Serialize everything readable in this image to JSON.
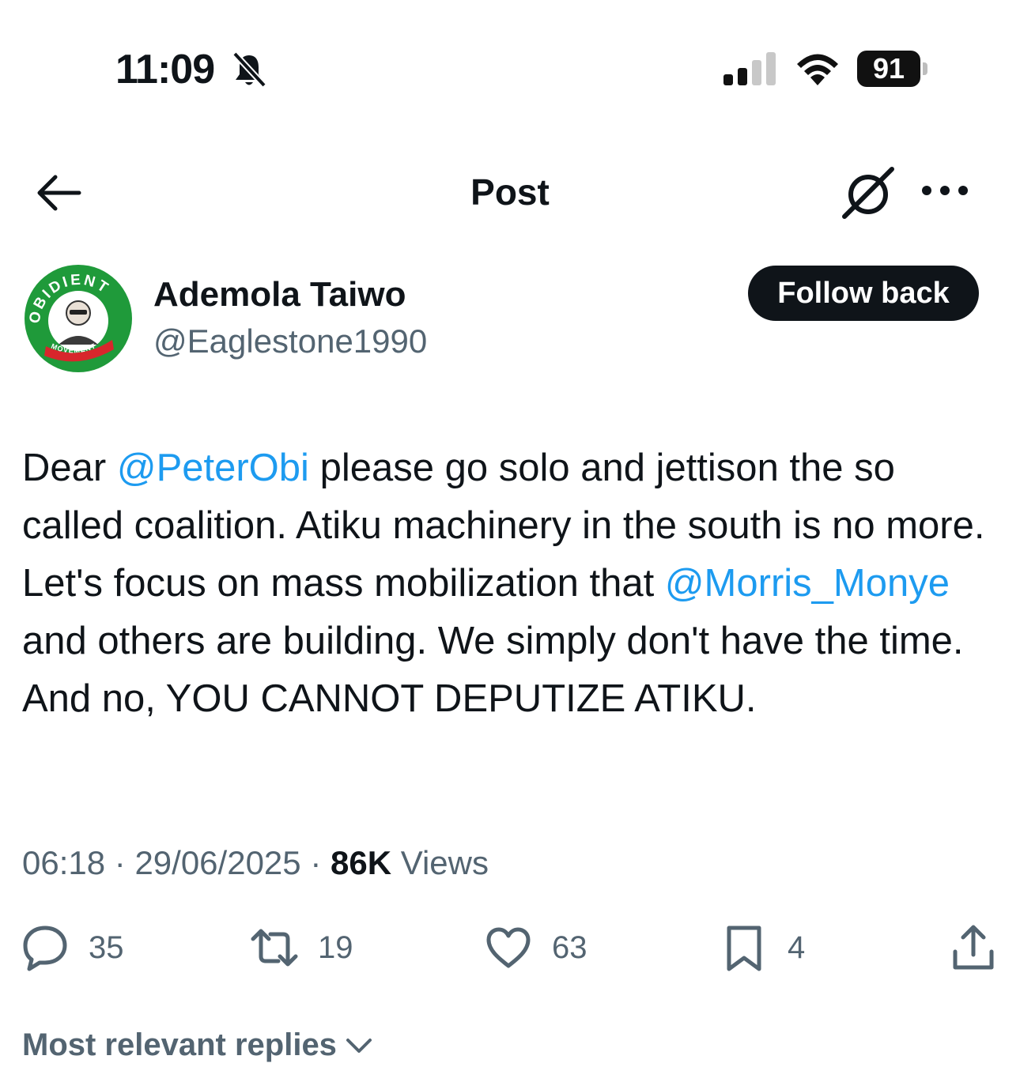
{
  "status_bar": {
    "time": "11:09",
    "battery": "91",
    "icons": [
      "bell-slash-icon",
      "signal-icon",
      "wifi-icon",
      "battery-icon"
    ]
  },
  "header": {
    "title": "Post",
    "icons": [
      "back-arrow-icon",
      "grok-icon",
      "more-icon"
    ]
  },
  "author": {
    "name": "Ademola Taiwo",
    "handle": "@Eaglestone1990",
    "avatar_text_top": "OBIDIENT",
    "avatar_text_bottom": "MOVEMENT",
    "follow_label": "Follow back"
  },
  "post": {
    "seg1": "Dear ",
    "mention1": "@PeterObi",
    "seg2": " please go solo and jettison the so called coalition. Atiku machinery in the south is no more. Let's focus on mass mobilization that ",
    "mention2": "@Morris_Monye",
    "seg3": " and others are building. We simply don't have the time. And no, YOU CANNOT DEPUTIZE ATIKU.",
    "time": "06:18",
    "date": "29/06/2025",
    "views_count": "86K",
    "views_label": "Views"
  },
  "actions": {
    "replies": "35",
    "reposts": "19",
    "likes": "63",
    "bookmarks": "4"
  },
  "replies_filter": "Most relevant replies",
  "colors": {
    "accent": "#1d9bf0",
    "text": "#0f1419",
    "muted": "#536471",
    "avatar_green": "#1f9a3a",
    "avatar_red": "#d8262c"
  }
}
